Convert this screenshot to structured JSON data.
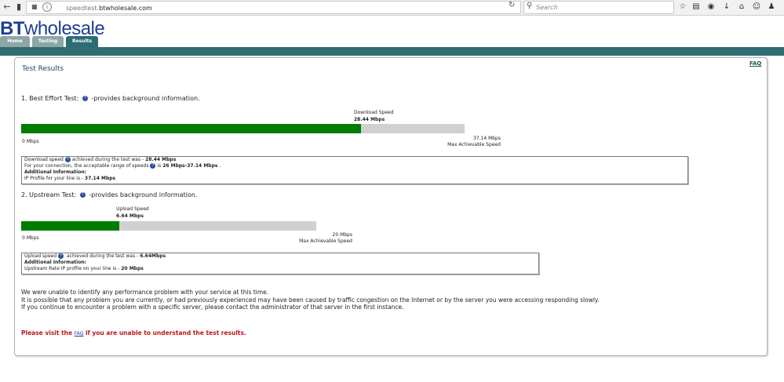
{
  "browser": {
    "url_prefix": "speedtest.",
    "url_domain": "btwholesale.com",
    "search_placeholder": "Search"
  },
  "site": {
    "logo_bold": "BT",
    "logo_text": "wholesale",
    "tabs": [
      "Home",
      "Testing",
      "Results"
    ],
    "active_tab": "Results",
    "faq_link": "FAQ"
  },
  "page": {
    "title": "Test Results"
  },
  "download": {
    "heading": "1. Best Effort Test:",
    "heading_suffix": "-provides background information.",
    "speed_label": "Download Speed",
    "speed_value": "28.44 Mbps",
    "min_label": "0 Mbps",
    "max_value": "37.14 Mbps",
    "max_label": "Max Achievable Speed",
    "fill_fraction": 0.766,
    "info_line1_pre": "Download speed",
    "info_line1_mid": "achieved during the test was - ",
    "info_line1_val": "28.44 Mbps",
    "info_line2_pre": "For your connection, the acceptable range of speeds",
    "info_line2_mid": "is ",
    "info_line2_val": "26 Mbps-37.14 Mbps",
    "info_line2_end": " .",
    "info_line3": "Additional Information:",
    "info_line4_pre": "IP Profile for your line is - ",
    "info_line4_val": "37.14 Mbps"
  },
  "upload": {
    "heading": "2. Upstream Test:",
    "heading_suffix": "-provides background information.",
    "speed_label": "Upload Speed",
    "speed_value": "6.64 Mbps",
    "min_label": "0 Mbps",
    "max_value": "20 Mbps",
    "max_label": "Max Achievable Speed",
    "fill_fraction": 0.332,
    "info_line1_pre": "Upload speed",
    "info_line1_mid": " achieved during the test was - ",
    "info_line1_val": "6.64Mbps",
    "info_line2": "Additional Information:",
    "info_line3_pre": "Upstream Rate IP profile on your line is - ",
    "info_line3_val": "20 Mbps"
  },
  "summary": {
    "line1": "We were unable to identify any performance problem with your service at this time.",
    "line2": "It is possible that any problem you are currently, or had previously experienced may have been caused by traffic congestion on the Internet or by the server you were accessing responding slowly.",
    "line3": "If you continue to encounter a problem with a specific server, please contact the administrator of that server in the first instance."
  },
  "visit": {
    "pre": "Please visit the ",
    "link": "FAQ",
    "post": " if you are unable to understand the test results."
  },
  "colors": {
    "brand_blue": "#1d3f91",
    "band_teal": "#2f6d73",
    "bar_green": "#007d00",
    "bar_grey": "#d0d0d0",
    "warning_red": "#c0141c"
  }
}
